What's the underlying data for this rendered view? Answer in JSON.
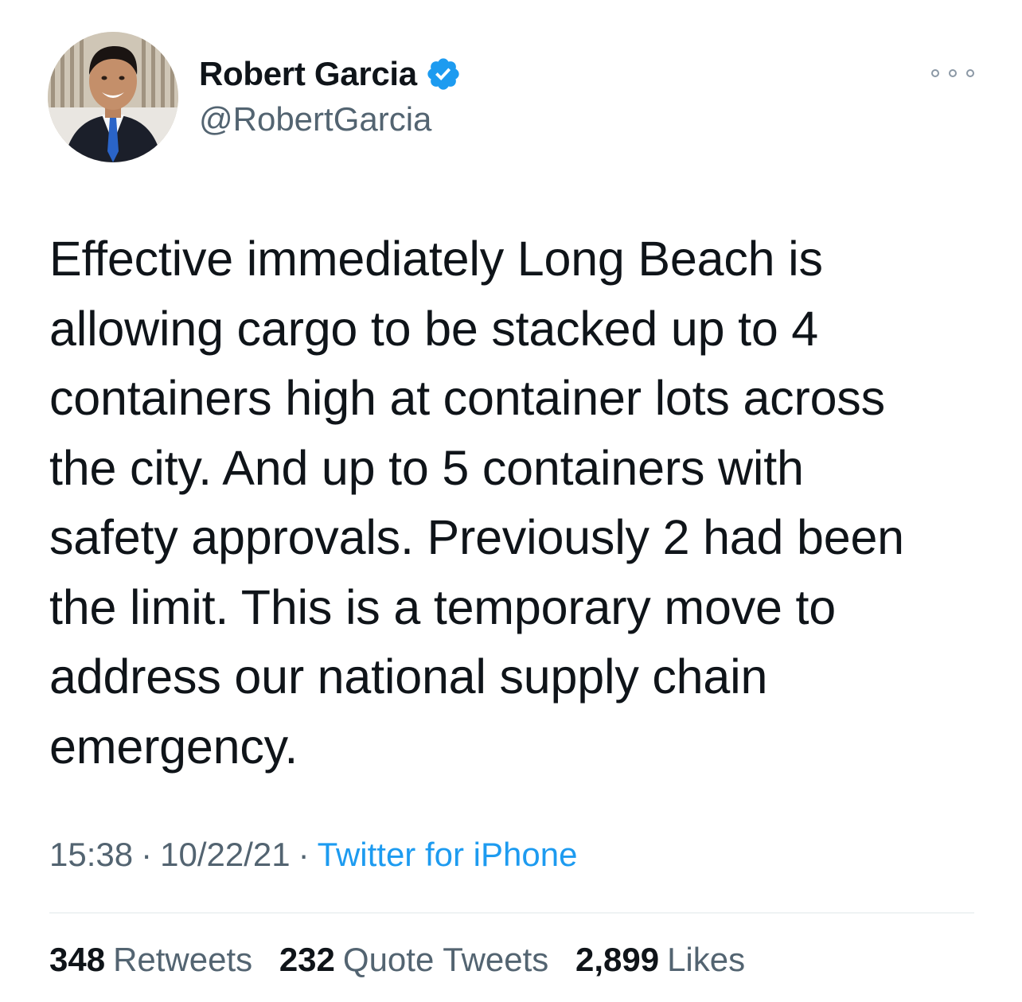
{
  "author": {
    "display_name": "Robert Garcia",
    "handle": "@RobertGarcia",
    "verified": true,
    "verified_icon": "verified-badge-icon",
    "avatar_icon": "profile-photo"
  },
  "tweet": {
    "text_lines": [
      "Effective immediately Long Beach is",
      "allowing cargo to be stacked up to 4",
      "containers high at container lots across",
      "the city. And up to 5 containers with",
      "safety approvals. Previously 2 had been",
      "the limit. This is a temporary move to",
      "address our national supply chain",
      "emergency."
    ],
    "time": "15:38",
    "date": "10/22/21",
    "separator": "·",
    "source": "Twitter for iPhone"
  },
  "stats": {
    "retweets_count": "348",
    "retweets_label": "Retweets",
    "quotes_count": "232",
    "quotes_label": "Quote Tweets",
    "likes_count": "2,899",
    "likes_label": "Likes"
  },
  "colors": {
    "text_primary": "#0f1419",
    "text_secondary": "#536471",
    "link": "#1d9bf0",
    "verified": "#1d9bf0",
    "divider": "#eff3f4"
  },
  "more_icon": "more-options-icon"
}
